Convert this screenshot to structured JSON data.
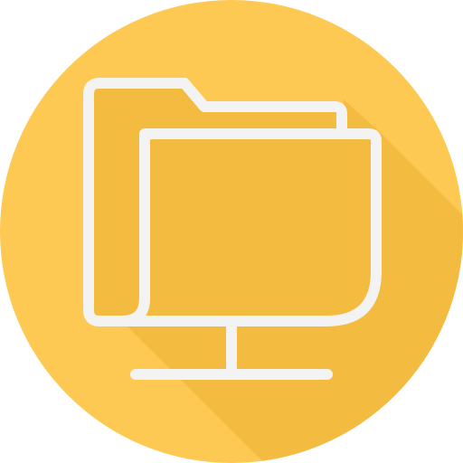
{
  "icon": {
    "name": "network-folder-icon",
    "colors": {
      "circle": "#FDC953",
      "shadow": "#F4BB41",
      "folder_fill": "#F4BB41",
      "stroke": "#F3F3F3"
    }
  }
}
